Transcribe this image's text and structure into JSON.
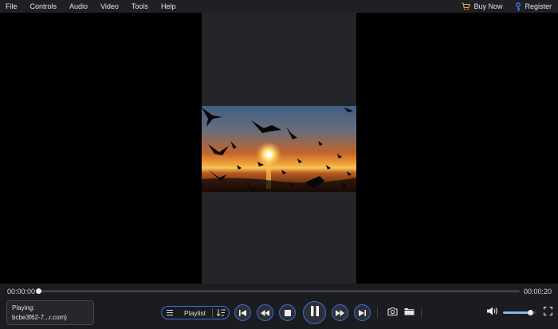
{
  "menu": {
    "items": [
      "File",
      "Controls",
      "Audio",
      "Video",
      "Tools",
      "Help"
    ],
    "buy_now": "Buy Now",
    "register": "Register"
  },
  "player": {
    "current_time": "00:00:00",
    "total_time": "00:00:20",
    "progress": 0.0,
    "volume": 0.8
  },
  "now_playing": {
    "label": "Playing:",
    "file": "bcbe3f62-7...r.com)"
  },
  "playlist": {
    "label": "Playlist"
  },
  "colors": {
    "accent": "#3c6ee0",
    "progress": "#8ab4ff",
    "cart": "#e8a13a",
    "key": "#3c7bff"
  }
}
